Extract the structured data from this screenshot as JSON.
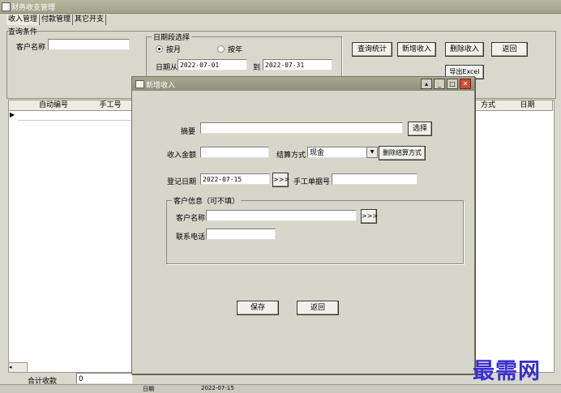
{
  "window": {
    "title": "财务收支管理"
  },
  "tabs": [
    {
      "label": "收入管理"
    },
    {
      "label": "付款管理"
    },
    {
      "label": "其它开支"
    }
  ],
  "query": {
    "group_label": "查询条件",
    "customer_label": "客户名称",
    "customer_value": "",
    "date_group_label": "日期段选择",
    "by_month_label": "按月",
    "by_year_label": "按年",
    "date_from_label": "日期从",
    "date_from_value": "2022-07-01",
    "date_to_label": "到",
    "date_to_value": "2022-07-31",
    "btn_query": "查询统计",
    "btn_add": "新增收入",
    "btn_delete": "删除收入",
    "btn_back": "返回",
    "btn_export": "导出Excel"
  },
  "grid": {
    "columns": [
      "自动编号",
      "手工号",
      "方式",
      "日期"
    ]
  },
  "footer": {
    "total_label": "合计收款",
    "total_value": "0",
    "date_label": "日期",
    "date_value": "2022-07-15"
  },
  "modal": {
    "title": "新增收入",
    "summary_label": "摘要",
    "summary_value": "",
    "select_btn": "选择",
    "amount_label": "收入金额",
    "amount_value": "",
    "settle_label": "结算方式",
    "settle_value": "现金",
    "delete_settle_btn": "删除结算方式",
    "reg_date_label": "登记日期",
    "reg_date_value": "2022-07-15",
    "more_btn": ">>>",
    "manual_no_label": "手工单据号",
    "manual_no_value": "",
    "cust_group_label": "客户信息（可不填）",
    "cust_name_label": "客户名称",
    "cust_name_value": "",
    "cust_more_btn": ">>>",
    "phone_label": "联系电话",
    "phone_value": "",
    "save_btn": "保存",
    "back_btn": "返回"
  },
  "watermark": "最需网",
  "colors": {
    "accent_close": "#d44a3a",
    "watermark": "#3a2ed1"
  }
}
